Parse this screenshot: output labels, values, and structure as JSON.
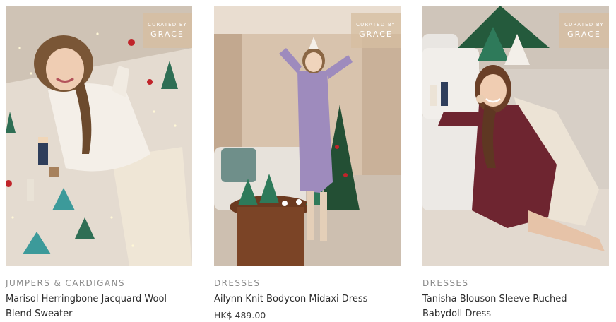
{
  "products": [
    {
      "category": "JUMPERS & CARDIGANS",
      "title": "Marisol Herringbone Jacquard Wool Blend Sweater",
      "price": "",
      "badge_top": "CURATED BY",
      "badge_name": "GRACE"
    },
    {
      "category": "DRESSES",
      "title": "Ailynn Knit Bodycon Midaxi Dress",
      "price": "HK$ 489.00",
      "badge_top": "CURATED BY",
      "badge_name": "GRACE"
    },
    {
      "category": "DRESSES",
      "title": "Tanisha Blouson Sleeve Ruched Babydoll Dress",
      "price": "",
      "badge_top": "CURATED BY",
      "badge_name": "GRACE"
    }
  ],
  "colors": {
    "badge_bg": "#d6bea0",
    "category_text": "#8a8a8a",
    "title_text": "#2b2b2b"
  }
}
